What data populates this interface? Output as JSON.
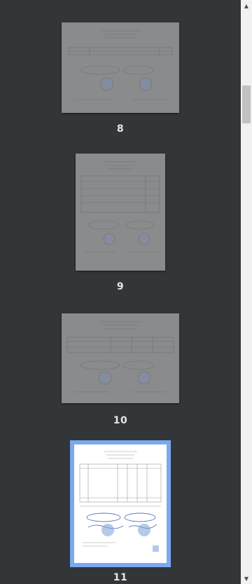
{
  "thumbnails": [
    {
      "page_label": "8",
      "selected": false
    },
    {
      "page_label": "9",
      "selected": false
    },
    {
      "page_label": "10",
      "selected": false
    },
    {
      "page_label": "11",
      "selected": true
    }
  ],
  "scrollbar": {
    "up_icon": "▲",
    "down_icon": "▼"
  },
  "colors": {
    "panel_background": "#323639",
    "selection_outline": "#7aa9ee",
    "dimmed_page": "#8a8b8c"
  }
}
